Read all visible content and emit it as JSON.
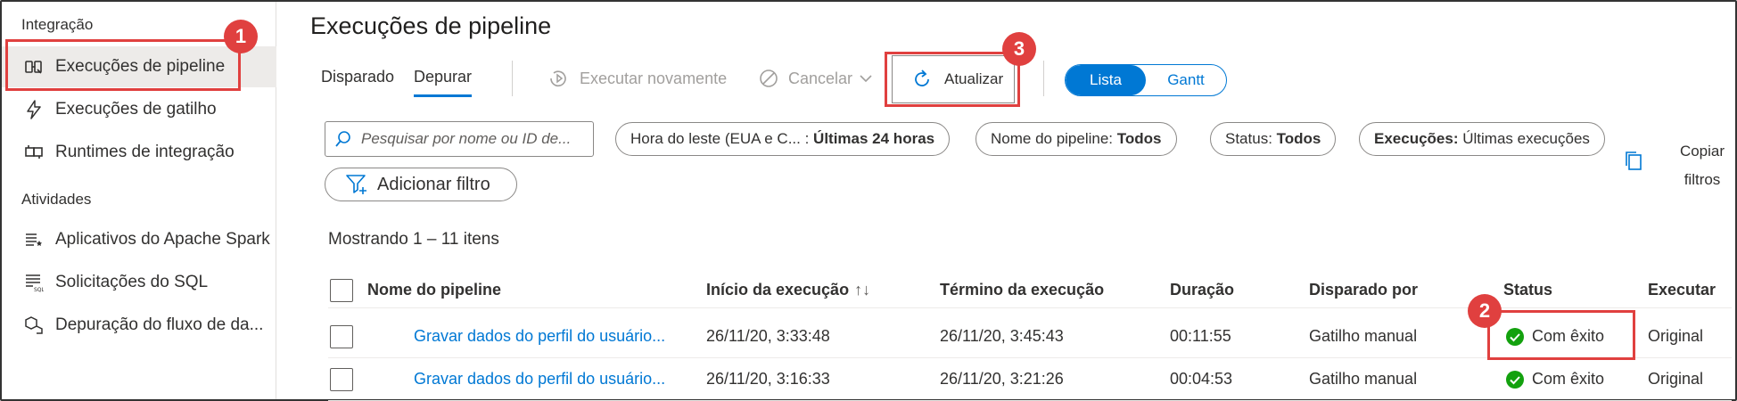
{
  "sidebar": {
    "section_integration": "Integração",
    "section_activities": "Atividades",
    "items": [
      {
        "label": "Execuções de pipeline",
        "icon": "pipeline-runs-icon"
      },
      {
        "label": "Execuções de gatilho",
        "icon": "trigger-icon"
      },
      {
        "label": "Runtimes de integração",
        "icon": "integration-runtime-icon"
      },
      {
        "label": "Aplicativos do Apache Spark",
        "icon": "spark-apps-icon"
      },
      {
        "label": "Solicitações do SQL",
        "icon": "sql-requests-icon"
      },
      {
        "label": "Depuração do fluxo de da...",
        "icon": "dataflow-debug-icon"
      }
    ]
  },
  "main": {
    "title": "Execuções de pipeline",
    "tabs": [
      {
        "label": "Disparado",
        "active": false
      },
      {
        "label": "Depurar",
        "active": true
      }
    ],
    "toolbar": {
      "rerun_label": "Executar novamente",
      "cancel_label": "Cancelar",
      "refresh_label": "Atualizar"
    },
    "view_toggle": {
      "list": "Lista",
      "gantt": "Gantt",
      "selected": "Lista"
    },
    "search": {
      "placeholder": "Pesquisar por nome ou ID de..."
    },
    "filters": [
      {
        "key": "Hora do leste (EUA e C... :",
        "value": "Últimas 24 horas"
      },
      {
        "key": "Nome do pipeline:",
        "value": "Todos"
      },
      {
        "key": "Status:",
        "value": "Todos"
      },
      {
        "key": "Execuções:",
        "value": "Últimas execuções"
      }
    ],
    "add_filter_label": "Adicionar filtro",
    "copy_filters_line1": "Copiar",
    "copy_filters_line2": "filtros",
    "showing_text": "Mostrando 1 – 11 itens",
    "table": {
      "columns": [
        "Nome do pipeline",
        "Início da execução",
        "Término da execução",
        "Duração",
        "Disparado por",
        "Status",
        "Executar"
      ],
      "sort_indicator": "↑↓",
      "rows": [
        {
          "name": "Gravar dados do perfil do usuário...",
          "start": "26/11/20, 3:33:48",
          "end": "26/11/20, 3:45:43",
          "duration": "00:11:55",
          "triggered_by": "Gatilho manual",
          "status": "Com êxito",
          "run": "Original"
        },
        {
          "name": "Gravar dados do perfil do usuário...",
          "start": "26/11/20, 3:16:33",
          "end": "26/11/20, 3:21:26",
          "duration": "00:04:53",
          "triggered_by": "Gatilho manual",
          "status": "Com êxito",
          "run": "Original"
        }
      ]
    }
  },
  "annotations": {
    "badge1": "1",
    "badge2": "2",
    "badge3": "3"
  },
  "colors": {
    "accent": "#0078d4",
    "callout": "#e0403f",
    "success": "#13a10e"
  }
}
